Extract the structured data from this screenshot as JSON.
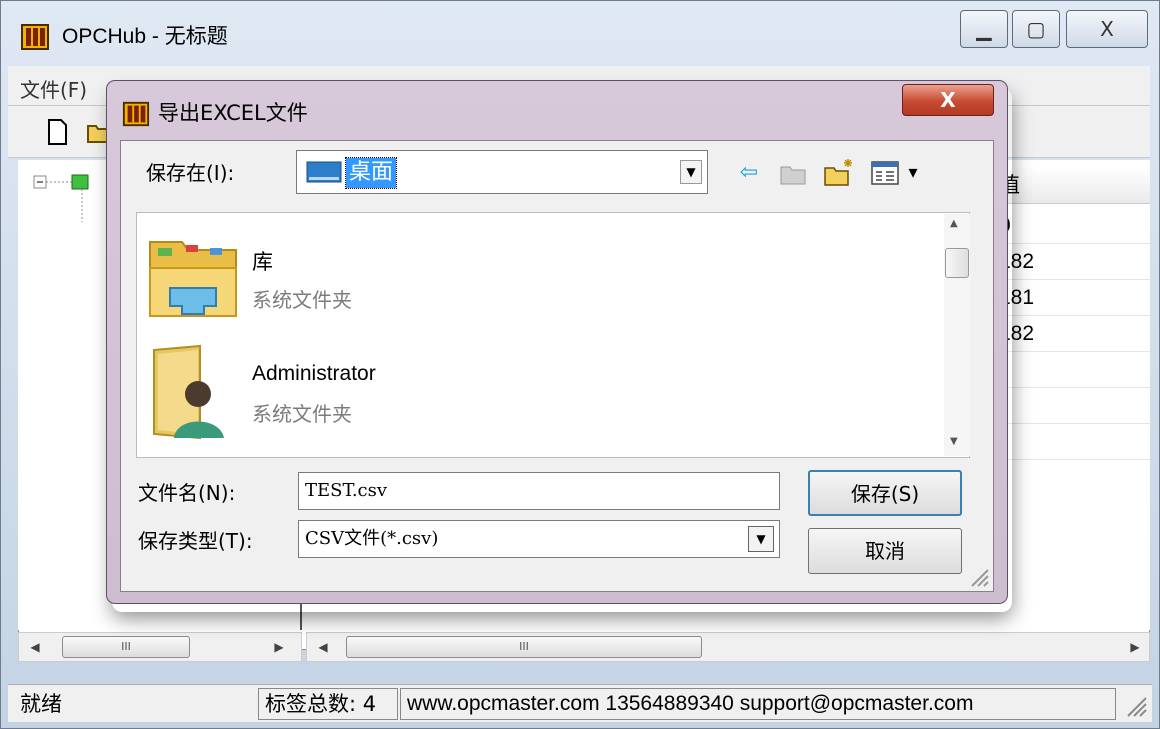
{
  "window": {
    "title": "OPCHub - 无标题",
    "min_symbol": "▁",
    "max_symbol": "▢",
    "close_symbol": "X"
  },
  "menu": {
    "file": "文件(F)"
  },
  "list": {
    "value_header": "值",
    "values": [
      "0",
      "182",
      "181",
      "182"
    ]
  },
  "scroll_grip": "III",
  "status": {
    "ready": "就绪",
    "tag_count": "标签总数: 4",
    "contact": "www.opcmaster.com 13564889340 support@opcmaster.com"
  },
  "dialog": {
    "title": "导出EXCEL文件",
    "close_symbol": "X",
    "save_in_label": "保存在(I):",
    "save_in_value": "桌面",
    "back_icon_glyph": "⇦",
    "view_menu_glyph": "▾",
    "items": [
      {
        "name": "库",
        "type": "系统文件夹"
      },
      {
        "name": "Administrator",
        "type": "系统文件夹"
      }
    ],
    "filename_label": "文件名(N):",
    "filename_value": "TEST.csv",
    "filetype_label": "保存类型(T):",
    "filetype_value": "CSV文件(*.csv)",
    "save_button": "保存(S)",
    "cancel_button": "取消"
  }
}
